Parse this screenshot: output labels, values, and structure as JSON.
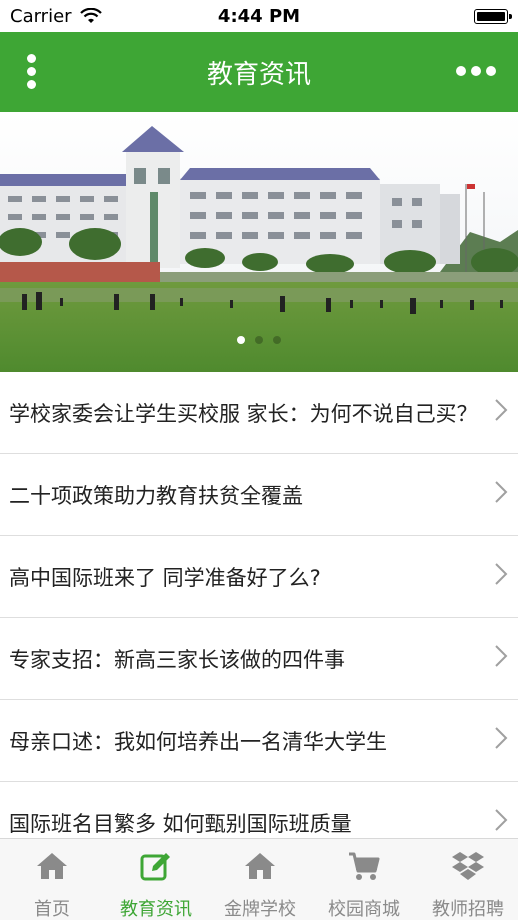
{
  "status_bar": {
    "carrier": "Carrier",
    "time": "4:44 PM"
  },
  "header": {
    "title": "教育资讯",
    "left_icon": "vertical-dots-icon",
    "right_icon": "horizontal-dots-icon",
    "color": "#3ea635"
  },
  "banner": {
    "image": "campus-photo",
    "page_count": 3,
    "active_page": 1
  },
  "news": [
    {
      "title": "学校家委会让学生买校服 家长：为何不说自己买？"
    },
    {
      "title": "二十项政策助力教育扶贫全覆盖"
    },
    {
      "title": "高中国际班来了 同学准备好了么?"
    },
    {
      "title": "专家支招：新高三家长该做的四件事"
    },
    {
      "title": "母亲口述：我如何培养出一名清华大学生"
    },
    {
      "title": "国际班名目繁多 如何甄别国际班质量"
    }
  ],
  "tabs": [
    {
      "label": "首页",
      "icon": "home-icon"
    },
    {
      "label": "教育资讯",
      "icon": "edit-icon",
      "active": true
    },
    {
      "label": "金牌学校",
      "icon": "home-icon"
    },
    {
      "label": "校园商城",
      "icon": "cart-icon"
    },
    {
      "label": "教师招聘",
      "icon": "dropbox-icon"
    }
  ],
  "colors": {
    "accent": "#3ea635",
    "inactive": "#8a8a8a"
  }
}
